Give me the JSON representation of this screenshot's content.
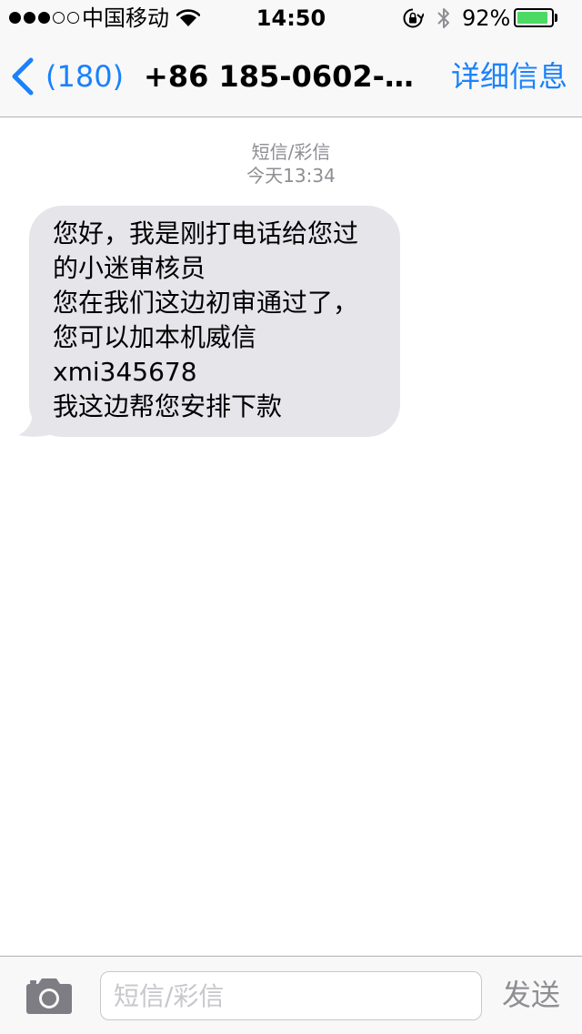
{
  "status_bar": {
    "signal_strength": 3,
    "signal_max": 5,
    "carrier": "中国移动",
    "time": "14:50",
    "battery_percent_text": "92%",
    "battery_level": 0.92,
    "battery_color": "#4cd964",
    "icons": [
      "wifi-icon",
      "rotation-lock-icon",
      "bluetooth-icon",
      "battery-icon"
    ]
  },
  "nav": {
    "back_label": "(180)",
    "title": "+86 185-0602-7...",
    "details_label": "详细信息",
    "accent_color": "#1a82fb"
  },
  "thread": {
    "message_type": "短信/彩信",
    "timestamp": "今天13:34",
    "messages": [
      {
        "direction": "incoming",
        "lines": [
          "您好，我是刚打电话给您过",
          "的小迷审核员",
          "您在我们这边初审通过了，",
          "您可以加本机威信",
          "xmi345678",
          "我这边帮您安排下款"
        ]
      }
    ]
  },
  "composer": {
    "placeholder": "短信/彩信",
    "send_label": "发送",
    "camera_icon": "camera-icon"
  }
}
